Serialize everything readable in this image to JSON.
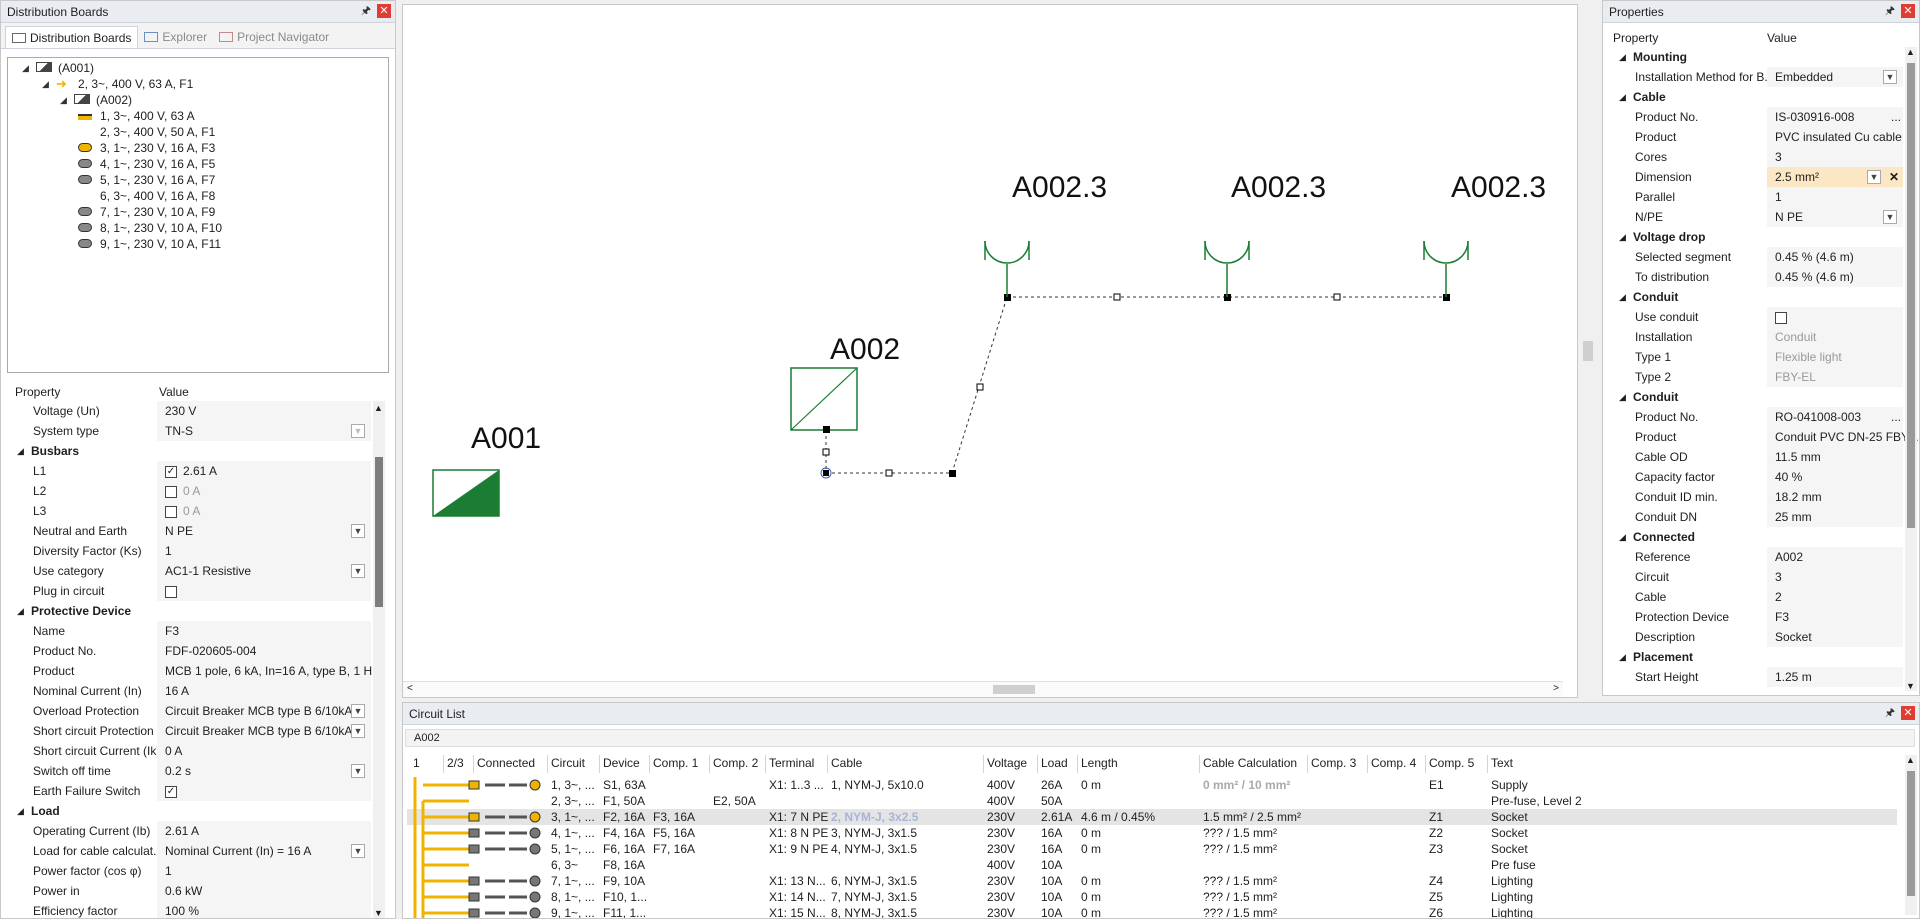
{
  "left_panel": {
    "title": "Distribution Boards",
    "tabs": [
      {
        "label": "Distribution Boards",
        "active": true
      },
      {
        "label": "Explorer",
        "active": false
      },
      {
        "label": "Project Navigator",
        "active": false
      }
    ],
    "tree": [
      {
        "label": "(A001)",
        "level": 0,
        "icon": "board-icon"
      },
      {
        "label": "2, 3~, 400 V, 63 A, F1",
        "level": 1,
        "icon": "arrow-feed-icon"
      },
      {
        "label": "(A002)",
        "level": 2,
        "icon": "board-icon"
      },
      {
        "label": "1, 3~, 400 V, 63 A",
        "level": 3,
        "icon": "supply-icon"
      },
      {
        "label": "2, 3~, 400 V, 50 A, F1",
        "level": 3,
        "icon": ""
      },
      {
        "label": "3, 1~, 230 V, 16 A, F3",
        "level": 3,
        "icon": "socket-selected-icon"
      },
      {
        "label": "4, 1~, 230 V, 16 A, F5",
        "level": 3,
        "icon": "socket-icon"
      },
      {
        "label": "5, 1~, 230 V, 16 A, F7",
        "level": 3,
        "icon": "socket-icon"
      },
      {
        "label": "6, 3~, 400 V, 16 A, F8",
        "level": 3,
        "icon": ""
      },
      {
        "label": "7, 1~, 230 V, 10 A, F9",
        "level": 3,
        "icon": "socket-icon"
      },
      {
        "label": "8, 1~, 230 V, 10 A, F10",
        "level": 3,
        "icon": "socket-icon"
      },
      {
        "label": "9, 1~, 230 V, 10 A, F11",
        "level": 3,
        "icon": "socket-icon"
      }
    ],
    "grid_header": {
      "property": "Property",
      "value": "Value"
    },
    "rows": [
      {
        "type": "row",
        "key": "Voltage (Un)",
        "value": "230 V"
      },
      {
        "type": "row",
        "key": "System type",
        "value": "TN-S",
        "dropdown": true,
        "disabled": true
      },
      {
        "type": "section",
        "key": "Busbars"
      },
      {
        "type": "check",
        "key": "L1",
        "value": "2.61 A",
        "checked": true
      },
      {
        "type": "check",
        "key": "L2",
        "value": "0 A",
        "checked": false,
        "dim": true
      },
      {
        "type": "check",
        "key": "L3",
        "value": "0 A",
        "checked": false,
        "dim": true
      },
      {
        "type": "row",
        "key": "Neutral and Earth",
        "value": "N PE",
        "dropdown": true
      },
      {
        "type": "row",
        "key": "Diversity Factor (Ks)",
        "value": "1"
      },
      {
        "type": "row",
        "key": "Use category",
        "value": "AC1-1 Resistive",
        "dropdown": true
      },
      {
        "type": "check",
        "key": "Plug in circuit",
        "value": "",
        "checked": false
      },
      {
        "type": "section",
        "key": "Protective Device"
      },
      {
        "type": "row",
        "key": "Name",
        "value": "F3"
      },
      {
        "type": "row",
        "key": "Product No.",
        "value": "FDF-020605-004"
      },
      {
        "type": "row",
        "key": "Product",
        "value": "MCB 1 pole, 6 kA, In=16 A, type B, 1 HP"
      },
      {
        "type": "row",
        "key": "Nominal Current (In)",
        "value": "16 A"
      },
      {
        "type": "row",
        "key": "Overload Protection",
        "value": "Circuit Breaker MCB type B 6/10kA",
        "dropdown": true
      },
      {
        "type": "row",
        "key": "Short circuit Protection",
        "value": "Circuit Breaker MCB type B 6/10kA",
        "dropdown": true
      },
      {
        "type": "row",
        "key": "Short circuit Current (Ik)",
        "value": "0 A"
      },
      {
        "type": "row",
        "key": "Switch off time",
        "value": "0.2 s",
        "dropdown": true
      },
      {
        "type": "check",
        "key": "Earth Failure Switch",
        "value": "",
        "checked": true
      },
      {
        "type": "section",
        "key": "Load"
      },
      {
        "type": "row",
        "key": "Operating Current (Ib)",
        "value": "2.61 A"
      },
      {
        "type": "row",
        "key": "Load for cable calculat...",
        "value": "Nominal Current (In) = 16 A",
        "dropdown": true
      },
      {
        "type": "row",
        "key": "Power factor (cos φ)",
        "value": "1"
      },
      {
        "type": "row",
        "key": "Power in",
        "value": "0.6 kW"
      },
      {
        "type": "row",
        "key": "Efficiency factor",
        "value": "100 %"
      }
    ]
  },
  "canvas": {
    "labels": {
      "a001": "A001",
      "a002": "A002",
      "s1": "A002.3",
      "s2": "A002.3",
      "s3": "A002.3"
    }
  },
  "properties_panel": {
    "title": "Properties",
    "grid_header": {
      "property": "Property",
      "value": "Value"
    },
    "rows": [
      {
        "type": "section",
        "key": "Mounting"
      },
      {
        "type": "row",
        "key": "Installation Method for B...",
        "value": "Embedded",
        "dropdown": true
      },
      {
        "type": "section",
        "key": "Cable"
      },
      {
        "type": "row",
        "key": "Product No.",
        "value": "IS-030916-008",
        "ellipsis": true
      },
      {
        "type": "row",
        "key": "Product",
        "value": "PVC insulated Cu cable ..."
      },
      {
        "type": "row",
        "key": "Cores",
        "value": "3"
      },
      {
        "type": "row",
        "key": "Dimension",
        "value": "2.5 mm²",
        "dropdown": true,
        "highlight": true,
        "clear": true
      },
      {
        "type": "row",
        "key": "Parallel",
        "value": "1"
      },
      {
        "type": "row",
        "key": "N/PE",
        "value": "N PE",
        "dropdown": true
      },
      {
        "type": "section",
        "key": "Voltage drop"
      },
      {
        "type": "row",
        "key": "Selected segment",
        "value": "0.45 % (4.6 m)"
      },
      {
        "type": "row",
        "key": "To distribution",
        "value": "0.45 % (4.6 m)"
      },
      {
        "type": "section",
        "key": "Conduit"
      },
      {
        "type": "check",
        "key": "Use conduit",
        "value": "",
        "checked": false
      },
      {
        "type": "row",
        "key": "Installation",
        "value": "Conduit",
        "dim": true
      },
      {
        "type": "row",
        "key": "Type 1",
        "value": "Flexible light",
        "dim": true
      },
      {
        "type": "row",
        "key": "Type 2",
        "value": "FBY-EL",
        "dim": true
      },
      {
        "type": "section",
        "key": "Conduit"
      },
      {
        "type": "row",
        "key": "Product No.",
        "value": "RO-041008-003",
        "ellipsis": true
      },
      {
        "type": "row",
        "key": "Product",
        "value": "Conduit PVC DN-25 FBY-..."
      },
      {
        "type": "row",
        "key": "Cable OD",
        "value": "11.5 mm"
      },
      {
        "type": "row",
        "key": "Capacity factor",
        "value": "40 %"
      },
      {
        "type": "row",
        "key": "Conduit ID min.",
        "value": "18.2 mm"
      },
      {
        "type": "row",
        "key": "Conduit DN",
        "value": "25 mm"
      },
      {
        "type": "section",
        "key": "Connected"
      },
      {
        "type": "row",
        "key": "Reference",
        "value": "A002"
      },
      {
        "type": "row",
        "key": "Circuit",
        "value": "3"
      },
      {
        "type": "row",
        "key": "Cable",
        "value": "2"
      },
      {
        "type": "row",
        "key": "Protection Device",
        "value": "F3"
      },
      {
        "type": "row",
        "key": "Description",
        "value": "Socket"
      },
      {
        "type": "section",
        "key": "Placement"
      },
      {
        "type": "row",
        "key": "Start Height",
        "value": "1.25 m"
      }
    ]
  },
  "circuit_list": {
    "title": "Circuit List",
    "board": "A002",
    "columns": [
      "1",
      "2/3",
      "Connected",
      "Circuit",
      "Device",
      "Comp. 1",
      "Comp. 2",
      "Terminal",
      "Cable",
      "Voltage",
      "Load",
      "Length",
      "Cable Calculation",
      "Comp. 3",
      "Comp. 4",
      "Comp. 5",
      "Text"
    ],
    "rows": [
      [
        "",
        "",
        "",
        "1, 3~, ...",
        "S1, 63A",
        "",
        "",
        "X1: 1..3 ...",
        "1, NYM-J, 5x10.0",
        "400V",
        "26A",
        "0 m",
        "0 mm² / 10 mm²",
        "",
        "",
        "E1",
        "Supply"
      ],
      [
        "",
        "",
        "",
        "2, 3~, ...",
        "F1, 50A",
        "",
        "E2, 50A",
        "",
        "",
        "400V",
        "50A",
        "",
        "",
        "",
        "",
        "",
        "Pre-fuse, Level 2"
      ],
      [
        "",
        "",
        "",
        "3, 1~, ...",
        "F2, 16A",
        "F3, 16A",
        "",
        "X1: 7 N PE",
        "2, NYM-J, 3x2.5",
        "230V",
        "2.61A",
        "4.6 m / 0.45%",
        "1.5 mm² / 2.5 mm²",
        "",
        "",
        "Z1",
        "Socket"
      ],
      [
        "",
        "",
        "",
        "4, 1~, ...",
        "F4, 16A",
        "F5, 16A",
        "",
        "X1: 8 N PE",
        "3, NYM-J, 3x1.5",
        "230V",
        "16A",
        "0 m",
        "??? / 1.5 mm²",
        "",
        "",
        "Z2",
        "Socket"
      ],
      [
        "",
        "",
        "",
        "5, 1~, ...",
        "F6, 16A",
        "F7, 16A",
        "",
        "X1: 9 N PE",
        "4, NYM-J, 3x1.5",
        "230V",
        "16A",
        "0 m",
        "??? / 1.5 mm²",
        "",
        "",
        "Z3",
        "Socket"
      ],
      [
        "",
        "",
        "",
        "6, 3~",
        "F8, 16A",
        "",
        "",
        "",
        "",
        "400V",
        "10A",
        "",
        "",
        "",
        "",
        "",
        "Pre fuse"
      ],
      [
        "",
        "",
        "",
        "7, 1~, ...",
        "F9, 10A",
        "",
        "",
        "X1: 13 N...",
        "6, NYM-J, 3x1.5",
        "230V",
        "10A",
        "0 m",
        "??? / 1.5 mm²",
        "",
        "",
        "Z4",
        "Lighting"
      ],
      [
        "",
        "",
        "",
        "8, 1~, ...",
        "F10, 1...",
        "",
        "",
        "X1: 14 N...",
        "7, NYM-J, 3x1.5",
        "230V",
        "10A",
        "0 m",
        "??? / 1.5 mm²",
        "",
        "",
        "Z5",
        "Lighting"
      ],
      [
        "",
        "",
        "",
        "9, 1~, ...",
        "F11, 1...",
        "",
        "",
        "X1: 15 N...",
        "8, NYM-J, 3x1.5",
        "230V",
        "10A",
        "0 m",
        "??? / 1.5 mm²",
        "",
        "",
        "Z6",
        "Lighting"
      ]
    ]
  },
  "colors": {
    "accent_green": "#1b7c34",
    "tree_yellow": "#f0b400",
    "selected_row": "#e4e4e4",
    "highlight_cell": "#fbe7c4"
  }
}
